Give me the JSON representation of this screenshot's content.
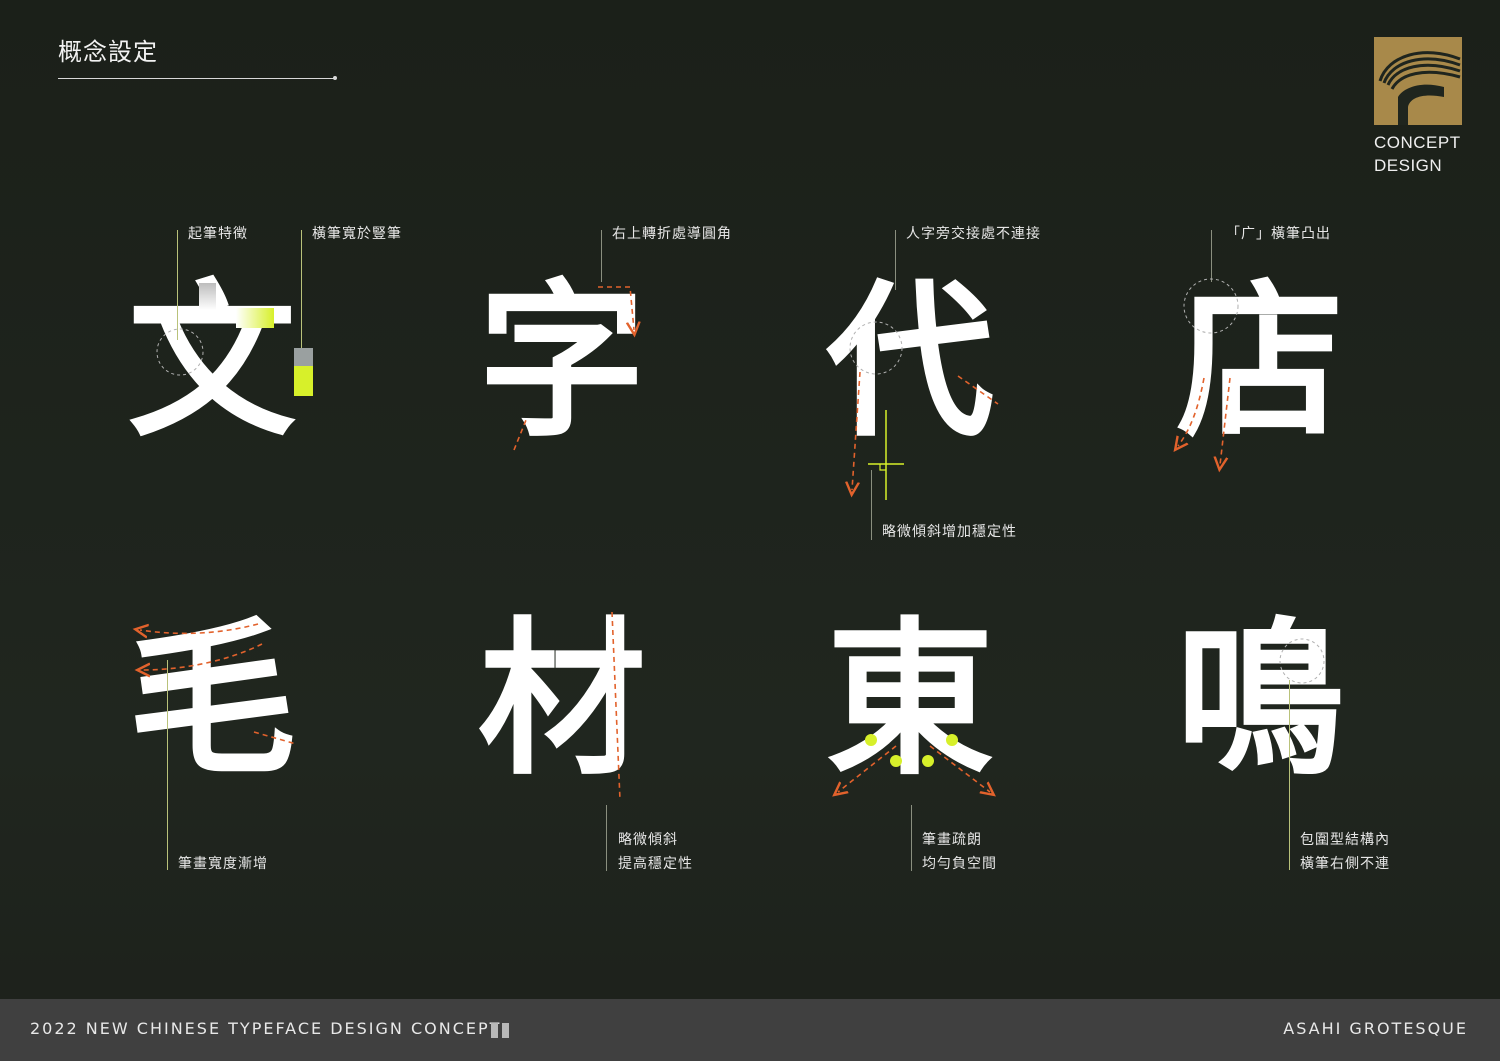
{
  "header": {
    "title": "概念設定"
  },
  "logo": {
    "text": "CONCEPT\nDESIGN",
    "brand_color": "#a8894a"
  },
  "glyphs": {
    "g1": "文",
    "g2": "字",
    "g3": "代",
    "g4": "店",
    "g5": "毛",
    "g6": "材",
    "g7": "東",
    "g8": "鳴"
  },
  "notes": {
    "n1": "起筆特徵",
    "n2": "橫筆寬於豎筆",
    "n3": "右上轉折處導圓角",
    "n4": "人字旁交接處不連接",
    "n5": "略微傾斜增加穩定性",
    "n6": "「广」橫筆凸出",
    "n7": "筆畫寬度漸增",
    "n8_line1": "略微傾斜",
    "n8_line2": "提高穩定性",
    "n9_line1": "筆畫疏朗",
    "n9_line2": "均勻負空間",
    "n10_line1": "包圍型結構內",
    "n10_line2": "橫筆右側不連"
  },
  "footer": {
    "left": "2022 NEW CHINESE TYPEFACE DESIGN CONCEPT",
    "right": "ASAHI GROTESQUE"
  },
  "colors": {
    "background": "#1f251e",
    "accent_yellow": "#d7f02a",
    "accent_orange": "#e2622c",
    "footer_bg": "#404040"
  }
}
